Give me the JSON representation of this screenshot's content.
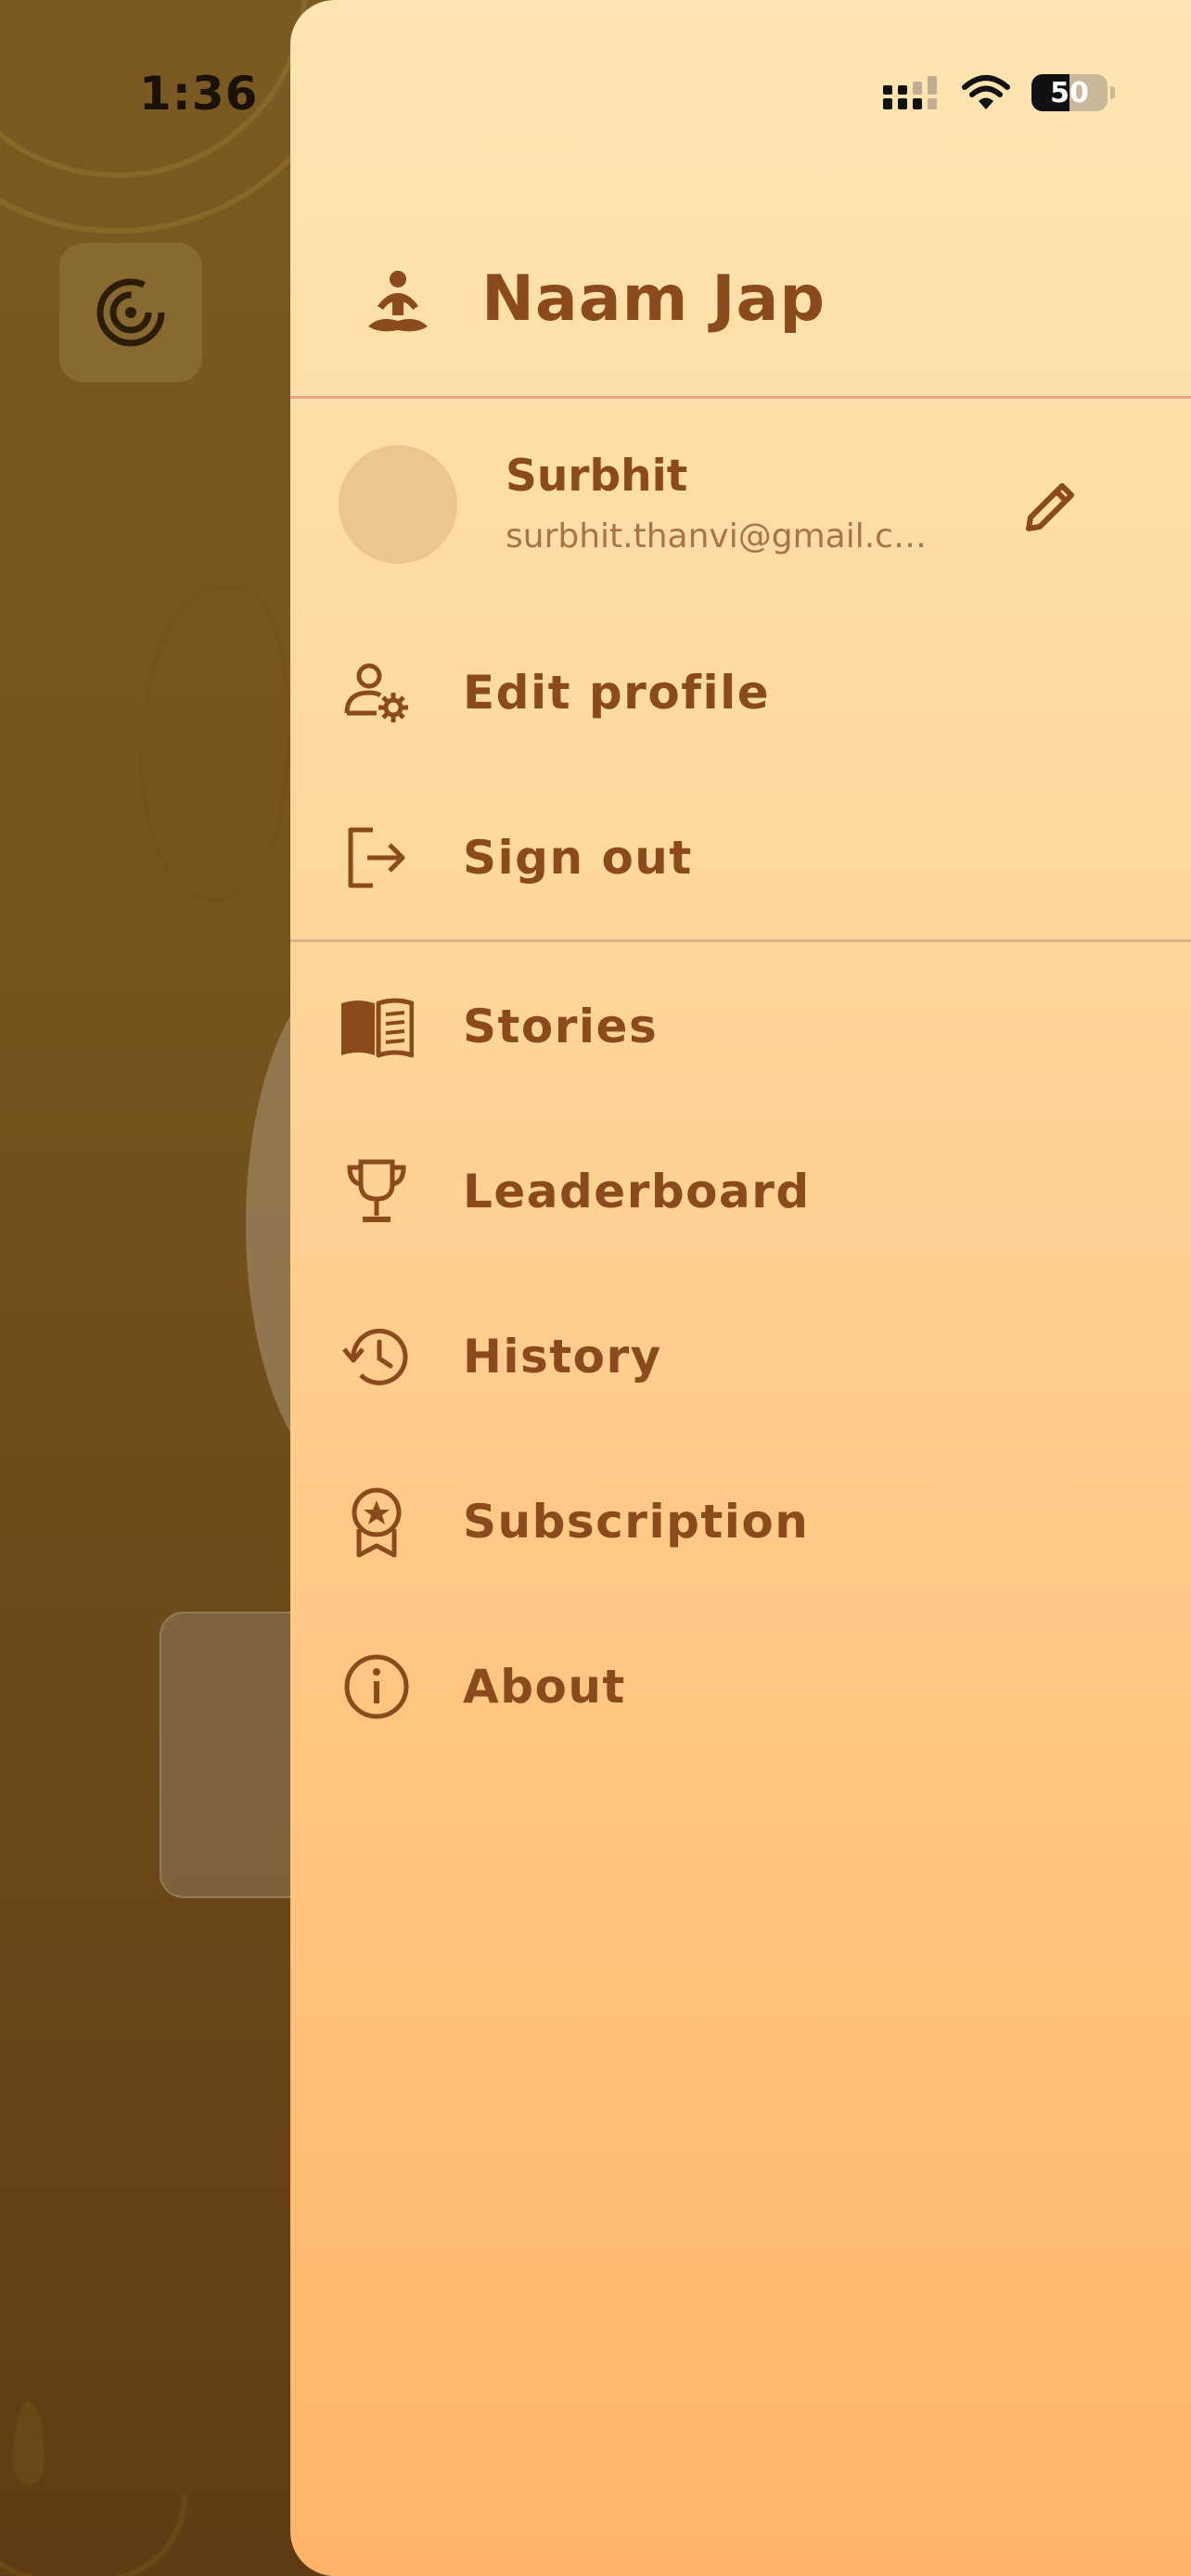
{
  "status_bar": {
    "time": "1:36",
    "battery": "50"
  },
  "drawer": {
    "app_title": "Naam Jap",
    "user": {
      "name": "Surbhit",
      "email": "surbhit.thanvi@gmail.com"
    },
    "account_items": [
      {
        "label": "Edit profile",
        "icon": "user-gear-icon"
      },
      {
        "label": "Sign out",
        "icon": "logout-icon"
      }
    ],
    "nav_items": [
      {
        "label": "Stories",
        "icon": "book-icon"
      },
      {
        "label": "Leaderboard",
        "icon": "trophy-icon"
      },
      {
        "label": "History",
        "icon": "history-icon"
      },
      {
        "label": "Subscription",
        "icon": "award-icon"
      },
      {
        "label": "About",
        "icon": "info-icon"
      }
    ]
  },
  "colors": {
    "accent": "#8a4a1c",
    "drawer_top": "#ffe5b3",
    "drawer_bottom": "#ffb46a"
  }
}
